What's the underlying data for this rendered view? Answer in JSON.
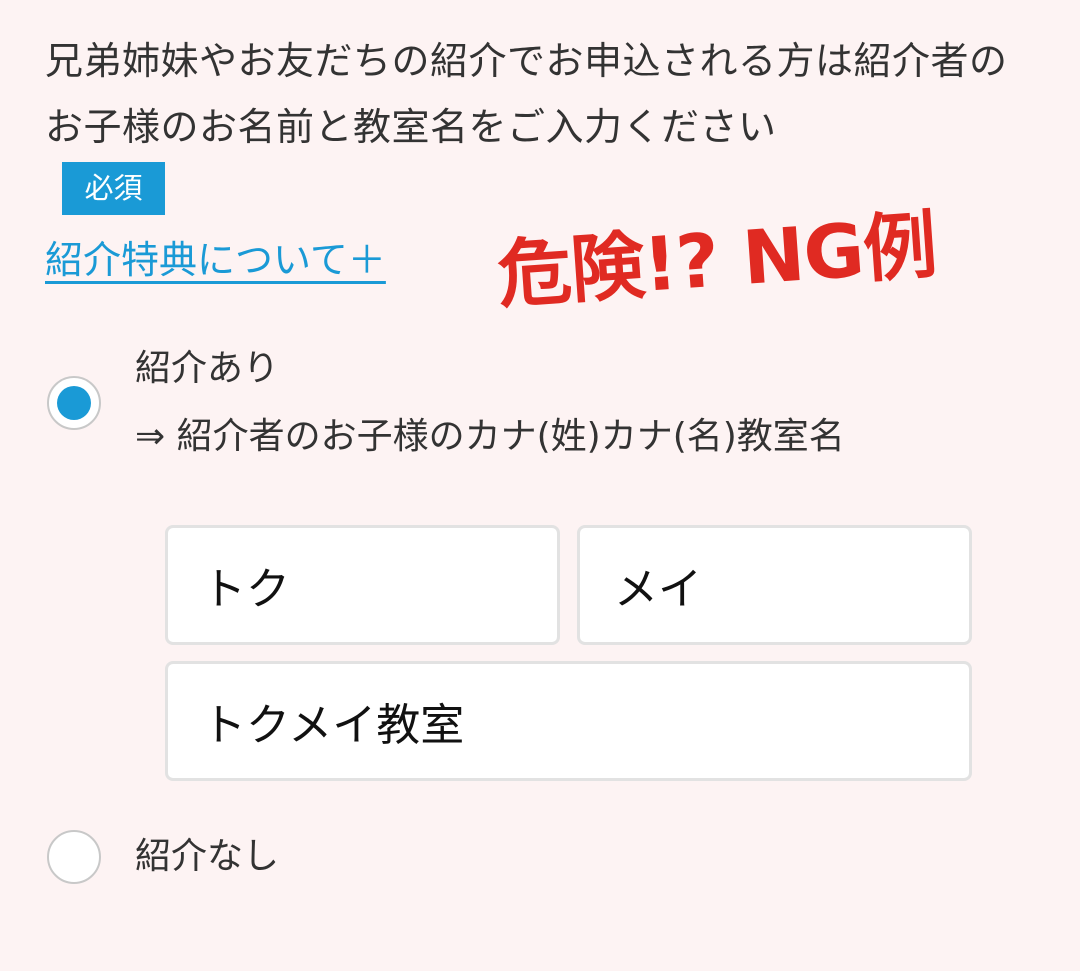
{
  "question": {
    "text": "兄弟姉妹やお友だちの紹介でお申込される方は紹介者のお子様のお名前と教室名をご入力ください",
    "required_badge": "必須",
    "benefit_link": "紹介特典について＋"
  },
  "annotation": {
    "text": "危険!? NG例",
    "color": "#e02a22"
  },
  "options": {
    "referral_yes": {
      "label": "紹介あり",
      "sublabel": "⇒ 紹介者のお子様のカナ(姓)カナ(名)教室名",
      "selected": true
    },
    "referral_no": {
      "label": "紹介なし",
      "selected": false
    }
  },
  "inputs": {
    "kana_last_name": "トク",
    "kana_first_name": "メイ",
    "class_name": "トクメイ教室"
  },
  "colors": {
    "accent": "#1a9ad6",
    "background": "#fdf3f3",
    "warning": "#e02a22"
  }
}
